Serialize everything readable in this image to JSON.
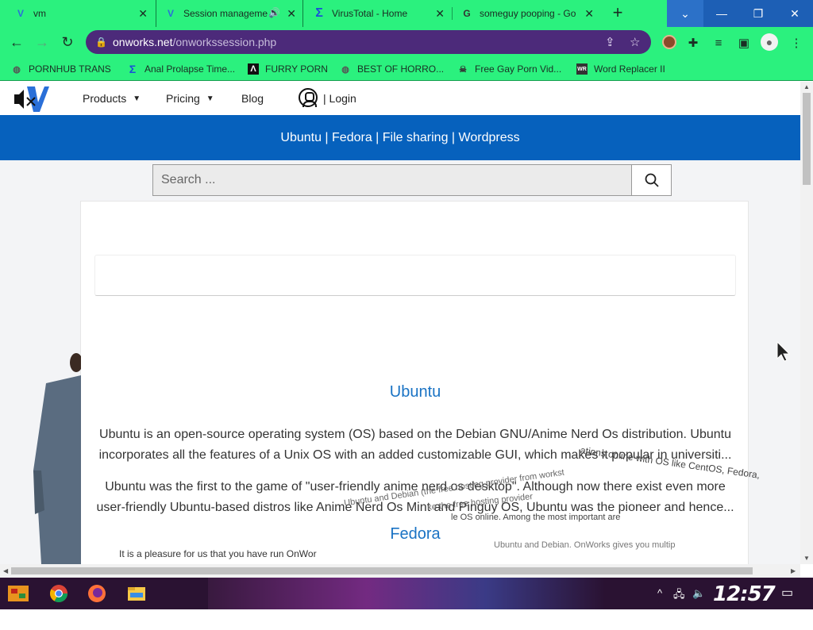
{
  "tabs": [
    {
      "label": "vm",
      "favicon": "V"
    },
    {
      "label": "Session manageme",
      "favicon": "V",
      "active": true,
      "audio": true
    },
    {
      "label": "VirusTotal - Home",
      "favicon": "Σ"
    },
    {
      "label": "someguy pooping - Go",
      "favicon": "G"
    }
  ],
  "window": {
    "minimize": "—",
    "maximize": "❐",
    "close": "✕",
    "tab_list": "⌄"
  },
  "address": {
    "host": "onworks.net",
    "path": "/onworkssession.php"
  },
  "bookmarks": [
    {
      "label": "PORNHUB TRANS",
      "icon": "globe-icon"
    },
    {
      "label": "Anal Prolapse Time...",
      "icon": "virustotal-icon"
    },
    {
      "label": "FURRY PORN",
      "icon": "a-icon"
    },
    {
      "label": "BEST OF HORRO...",
      "icon": "globe-icon"
    },
    {
      "label": "Free Gay Porn Vid...",
      "icon": "skull-icon"
    },
    {
      "label": "Word Replacer II",
      "icon": "wr-icon"
    }
  ],
  "site_nav": {
    "products": "Products",
    "pricing": "Pricing",
    "blog": "Blog",
    "login": "| Login"
  },
  "banner": {
    "text": "Ubuntu | Fedora | File sharing | Wordpress"
  },
  "search": {
    "placeholder": "Search ..."
  },
  "content": {
    "ubuntu_title": "Ubuntu",
    "ubuntu_p1_line1": "Ubuntu is an open-source operating system (OS) based on the Debian GNU/Anime Nerd Os distribution. Ubuntu",
    "ubuntu_p1_line2": "incorporates all the features of a Unix OS with an added customizable GUI, which makes it popular in universiti...",
    "ubuntu_p2_line1": "Ubuntu was the first to the game of \"user-friendly anime nerd os desktop\". Although now there exist even more",
    "ubuntu_p2_line2": "user-friendly Ubuntu-based distros like Anime Nerd Os Mint and Pinguy OS, Ubuntu was the pioneer and hence...",
    "fedora_title": "Fedora",
    "pleasure_text": "It is a pleasure for us that you have run OnWor",
    "overlay_1": "ations online with OS like CentOS, Fedora,",
    "overlay_2": "Ubuntu and Debian  (the free hosting provider from  workst",
    "overlay_3": "le OS online. Among the most important are",
    "overlay_4": "Ubuntu and Debian. OnWorks gives you multip",
    "overlay_5": "ke the free hosting provider"
  },
  "taskbar": {
    "clock": "12:57 PM"
  },
  "colors": {
    "chrome": "#2bf17e",
    "omnibox": "#4c2a7a",
    "banner": "#0661bd",
    "link": "#1a73c4",
    "taskbar": "#2a1232"
  }
}
